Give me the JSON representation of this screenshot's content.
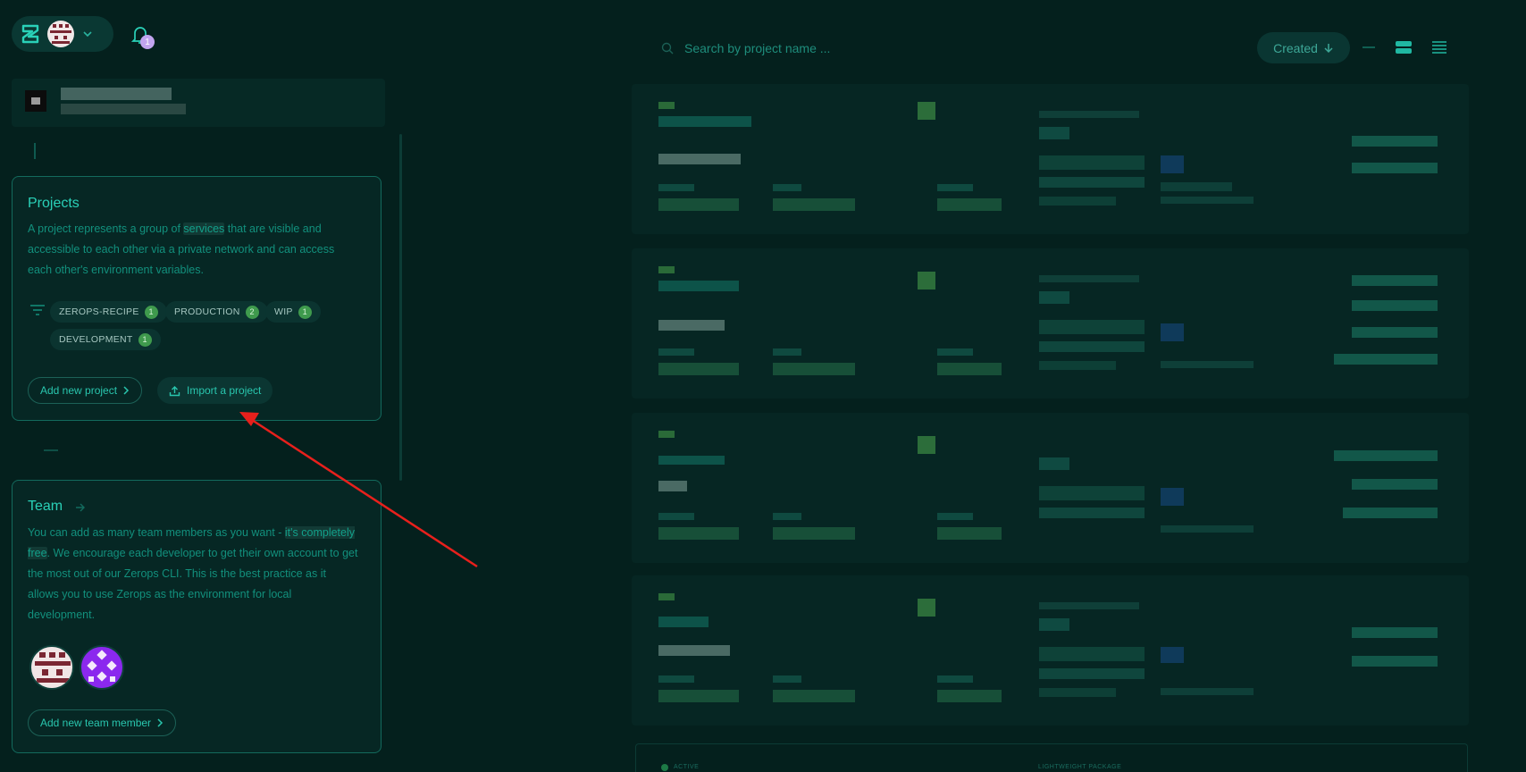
{
  "header": {
    "notification_count": "1"
  },
  "projects_card": {
    "title": "Projects",
    "desc_part1": "A project represents a group of ",
    "desc_highlight": "services",
    "desc_part2": " that are visible and accessible to each other via a private network and can access each other's environment variables.",
    "tags": [
      {
        "label": "ZEROPS-RECIPE",
        "count": "1"
      },
      {
        "label": "PRODUCTION",
        "count": "2"
      },
      {
        "label": "WIP",
        "count": "1"
      },
      {
        "label": "DEVELOPMENT",
        "count": "1"
      }
    ],
    "add_button": "Add new project",
    "import_button": "Import a project"
  },
  "team_card": {
    "title": "Team",
    "desc_part1": "You can add as many team members as you want - ",
    "desc_highlight": "it's completely free",
    "desc_part2": ". We encourage each developer to get their own account to get the most out of our Zerops CLI. This is the best practice as it allows you to use Zerops as the environment for local development.",
    "add_button": "Add new team member"
  },
  "search": {
    "placeholder": "Search by project name ..."
  },
  "sort": {
    "label": "Created"
  },
  "bottom_card": {
    "status": "ACTIVE",
    "package": "LIGHTWEIGHT PACKAGE"
  },
  "colors": {
    "background": "#04201d",
    "accent": "#2ad1b8",
    "annotation_arrow": "#e8201c",
    "badge": "#c2a4ef",
    "tag_count": "#3f9a4d"
  }
}
